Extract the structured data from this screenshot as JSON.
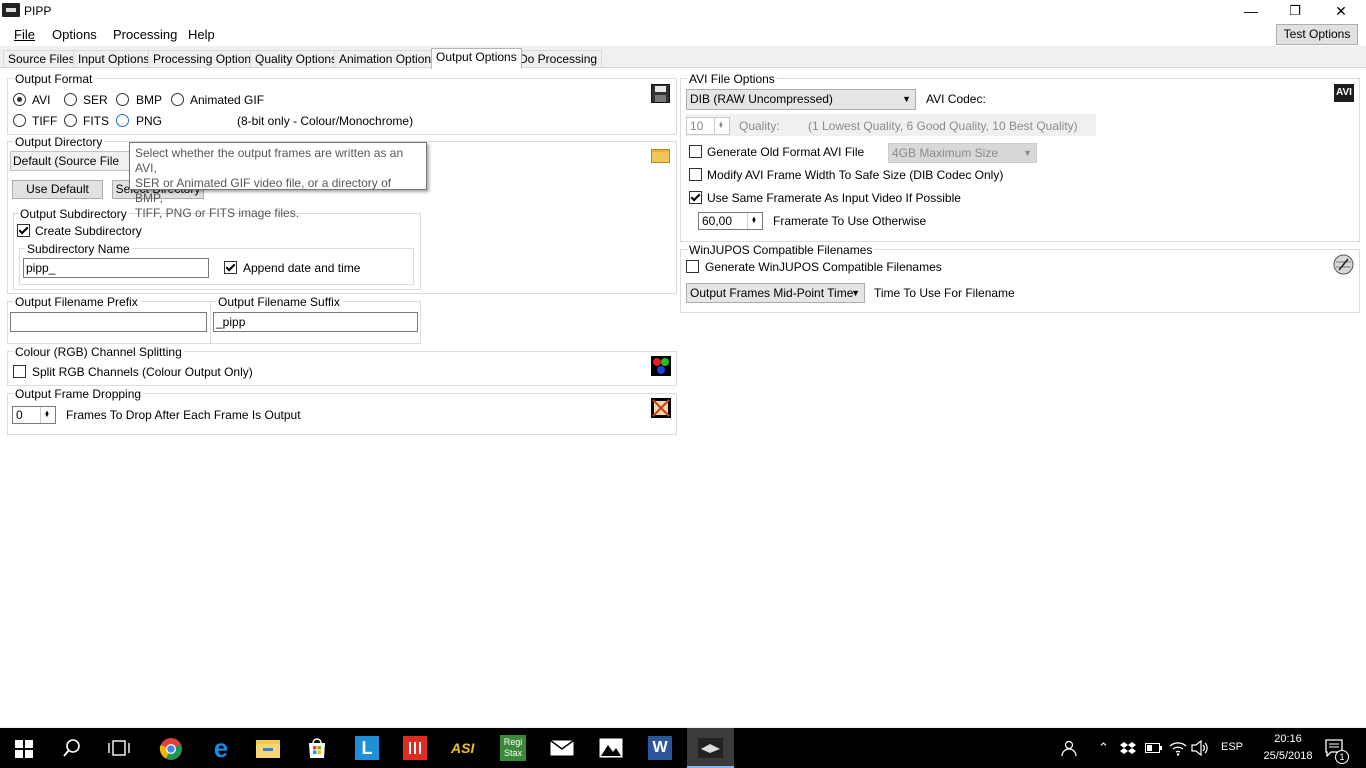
{
  "window": {
    "title": "PIPP",
    "minimize": "—",
    "maximize": "❐",
    "close": "✕"
  },
  "menu": {
    "file": "File",
    "options": "Options",
    "processing": "Processing",
    "help": "Help",
    "test_options": "Test Options"
  },
  "tabs": [
    "Source Files",
    "Input Options",
    "Processing Options",
    "Quality Options",
    "Animation Options",
    "Output Options",
    "Do Processing"
  ],
  "output_format": {
    "label": "Output Format",
    "options": [
      "AVI",
      "SER",
      "BMP",
      "Animated GIF",
      "TIFF",
      "FITS",
      "PNG"
    ],
    "selected": "AVI",
    "png_note": "(8-bit only - Colour/Monochrome)"
  },
  "tooltip": {
    "lines": [
      "Select whether the output frames are written as an AVI,",
      "SER or Animated GIF video file, or a directory of BMP,",
      "TIFF, PNG or FITS image files."
    ]
  },
  "output_directory": {
    "label": "Output Directory",
    "value": "Default (Source File Dire",
    "use_default": "Use Default",
    "select_directory": "Select Directory"
  },
  "output_subdirectory": {
    "label": "Output Subdirectory",
    "create_label": "Create Subdirectory",
    "create_checked": true,
    "name_label": "Subdirectory Name",
    "name_value": "pipp_",
    "append_label": "Append date and time",
    "append_checked": true
  },
  "filename": {
    "prefix_label": "Output Filename Prefix",
    "prefix_value": "",
    "suffix_label": "Output Filename Suffix",
    "suffix_value": "_pipp"
  },
  "rgb_split": {
    "label": "Colour (RGB) Channel Splitting",
    "checkbox_label": "Split RGB Channels (Colour Output Only)",
    "checked": false
  },
  "frame_dropping": {
    "label": "Output Frame Dropping",
    "value": "0",
    "text": "Frames To Drop After Each Frame Is Output"
  },
  "avi": {
    "label": "AVI File Options",
    "codec_value": "DIB (RAW Uncompressed)",
    "codec_label": "AVI Codec:",
    "quality_value": "10",
    "quality_label": "Quality:",
    "quality_hint": "(1 Lowest Quality, 6 Good Quality, 10 Best Quality)",
    "old_format_label": "Generate Old Format AVI File",
    "old_format_checked": false,
    "max_size_value": "4GB Maximum Size",
    "modify_width_label": "Modify AVI Frame Width To Safe Size (DIB Codec Only)",
    "modify_width_checked": false,
    "same_framerate_label": "Use Same Framerate As Input Video If Possible",
    "same_framerate_checked": true,
    "framerate_value": "60,00",
    "framerate_label": "Framerate To Use Otherwise",
    "badge": "AVI"
  },
  "winjupos": {
    "label": "WinJUPOS Compatible Filenames",
    "checkbox_label": "Generate WinJUPOS Compatible Filenames",
    "checked": false,
    "time_value": "Output Frames Mid-Point Time",
    "time_label": "Time To Use For Filename"
  },
  "taskbar": {
    "language": "ESP",
    "time": "20:16",
    "date": "25/5/2018",
    "notification_count": "1",
    "apps": [
      "windows-start",
      "search",
      "task-view",
      "chrome",
      "edge",
      "file-explorer",
      "store",
      "lightroom",
      "app-red",
      "asi-studio",
      "registax",
      "mail",
      "photos",
      "word",
      "pipp"
    ],
    "app_labels": {
      "lightroom": "L",
      "asi": "ASI",
      "registax": "Regi Stax",
      "word": "W"
    }
  },
  "colors": {
    "accent": "#0078d7",
    "active_taskbar": "#3b3b3b",
    "tooltip_border": "#767676"
  }
}
